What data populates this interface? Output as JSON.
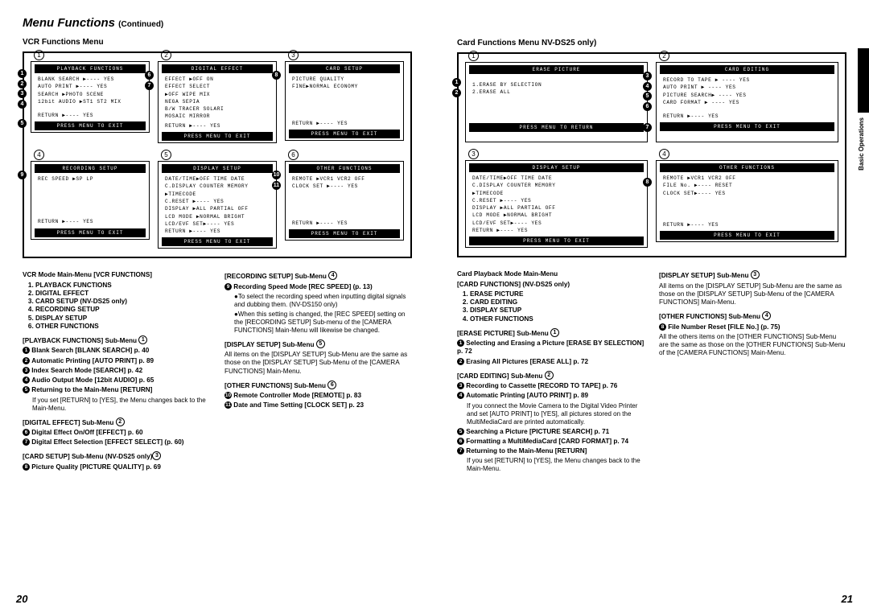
{
  "header": {
    "title": "Menu Functions",
    "continued": "(Continued)"
  },
  "side_tab": "Basic Operations",
  "page_numbers": {
    "left": "20",
    "right": "21"
  },
  "left": {
    "subtitle": "VCR Functions Menu",
    "screens": {
      "1": {
        "title": "PLAYBACK FUNCTIONS",
        "lines": [
          "BLANK SEARCH ▶---- YES",
          "AUTO PRINT  ▶---- YES",
          "SEARCH      ▶PHOTO SCENE",
          "12bit AUDIO ▶ST1 ST2 MIX"
        ],
        "return": "RETURN ▶---- YES",
        "footer": "PRESS MENU TO EXIT"
      },
      "2": {
        "title": "DIGITAL EFFECT",
        "lines": [
          "EFFECT      ▶OFF   ON",
          "EFFECT SELECT",
          "   ▶OFF  WIPE  MIX",
          "    NEGA       SEPIA",
          "    B/W  TRACER SOLARI",
          "    MOSAIC MIRROR"
        ],
        "return": "RETURN ▶---- YES",
        "footer": "PRESS MENU TO EXIT"
      },
      "3": {
        "title": "CARD SETUP",
        "lines": [
          "PICTURE QUALITY",
          "   FINE▶NORMAL ECONOMY"
        ],
        "return": "RETURN ▶---- YES",
        "footer": "PRESS MENU TO EXIT"
      },
      "4": {
        "title": "RECORDING SETUP",
        "lines": [
          "REC SPEED   ▶SP   LP"
        ],
        "return": "RETURN ▶---- YES",
        "footer": "PRESS MENU TO EXIT"
      },
      "5": {
        "title": "DISPLAY SETUP",
        "lines": [
          "DATE/TIME▶OFF TIME DATE",
          "C.DISPLAY COUNTER MEMORY",
          "          ▶TIMECODE",
          "C.RESET   ▶---- YES",
          "DISPLAY ▶ALL PARTIAL OFF",
          "LCD MODE  ▶NORMAL BRIGHT",
          "LCD/EVF SET▶---- YES"
        ],
        "return": "RETURN ▶---- YES",
        "footer": "PRESS MENU TO EXIT"
      },
      "6": {
        "title": "OTHER FUNCTIONS",
        "lines": [
          "REMOTE  ▶VCR1 VCR2 OFF",
          "CLOCK SET ▶----  YES"
        ],
        "return": "RETURN ▶---- YES",
        "footer": "PRESS MENU TO EXIT"
      }
    },
    "desc": {
      "main_title": "VCR Mode Main-Menu [VCR FUNCTIONS]",
      "main_items": [
        "PLAYBACK FUNCTIONS",
        "DIGITAL EFFECT",
        "CARD SETUP (NV-DS25 only)",
        "RECORDING SETUP",
        "DISPLAY SETUP",
        "OTHER FUNCTIONS"
      ],
      "sub1_title": "[PLAYBACK FUNCTIONS] Sub-Menu ",
      "sub1_items": [
        "Blank Search [BLANK SEARCH] p. 40",
        "Automatic Printing [AUTO PRINT] p. 89",
        "Index Search Mode [SEARCH] p. 42",
        "Audio Output Mode [12bit AUDIO] p. 65",
        "Returning to the Main-Menu [RETURN]"
      ],
      "sub1_note": "If you set [RETURN] to [YES], the Menu changes back to the Main-Menu.",
      "sub2_title": "[DIGITAL EFFECT] Sub-Menu ",
      "sub2_items": [
        "Digital Effect On/Off [EFFECT] p. 60",
        "Digital Effect Selection [EFFECT SELECT] (p. 60)"
      ],
      "sub3_title": "[CARD SETUP] Sub-Menu  (NV-DS25 only)",
      "sub3_items": [
        "Picture Quality [PICTURE QUALITY] p. 69"
      ],
      "sub4_title": "[RECORDING SETUP] Sub-Menu ",
      "sub4_items": [
        "Recording Speed Mode [REC SPEED] (p. 13)"
      ],
      "sub4_note1": "●To select the recording speed when inputting digital signals and dubbing them. (NV-DS150 only)",
      "sub4_note2": "●When this setting is changed, the [REC SPEED] setting on the [RECORDING SETUP] Sub-menu of the [CAMERA FUNCTIONS] Main-Menu will likewise be changed.",
      "sub5_title": "[DISPLAY SETUP] Sub-Menu ",
      "sub5_note": "All items on the [DISPLAY SETUP] Sub-Menu are the same as those on the [DISPLAY SETUP] Sub-Menu of the [CAMERA FUNCTIONS] Main-Menu.",
      "sub6_title": "[OTHER FUNCTIONS] Sub-Menu ",
      "sub6_items": [
        "Remote Controller Mode [REMOTE] p. 83",
        "Date and Time Setting [CLOCK SET] p. 23"
      ]
    }
  },
  "right": {
    "subtitle": "Card Functions Menu NV-DS25 only)",
    "screens": {
      "1": {
        "title": "ERASE PICTURE",
        "lines": [
          "1.ERASE BY SELECTION",
          "2.ERASE ALL"
        ],
        "footer": "PRESS MENU TO RETURN"
      },
      "2": {
        "title": "CARD EDITING",
        "lines": [
          "RECORD TO TAPE ▶ ---- YES",
          "AUTO PRINT    ▶ ---- YES",
          "PICTURE SEARCH▶ ---- YES",
          "CARD FORMAT   ▶ ---- YES"
        ],
        "return": "RETURN ▶---- YES",
        "footer": "PRESS MENU TO EXIT"
      },
      "3": {
        "title": "DISPLAY SETUP",
        "lines": [
          "DATE/TIME▶OFF TIME DATE",
          "C.DISPLAY COUNTER MEMORY",
          "          ▶TIMECODE",
          "C.RESET   ▶---- YES",
          "DISPLAY ▶ALL PARTIAL OFF",
          "LCD MODE  ▶NORMAL BRIGHT",
          "LCD/EVF SET▶---- YES"
        ],
        "return": "RETURN ▶---- YES",
        "footer": "PRESS MENU TO EXIT"
      },
      "4": {
        "title": "OTHER FUNCTIONS",
        "lines": [
          "REMOTE   ▶VCR1 VCR2 OFF",
          "FILE No. ▶----   RESET",
          "CLOCK SET▶----   YES"
        ],
        "return": "RETURN ▶---- YES",
        "footer": "PRESS MENU TO EXIT"
      }
    },
    "desc": {
      "main_title1": "Card Playback Mode Main-Menu",
      "main_title2": "[CARD FUNCTIONS] (NV-DS25 only)",
      "main_items": [
        "ERASE PICTURE",
        "CARD EDITING",
        "DISPLAY SETUP",
        "OTHER FUNCTIONS"
      ],
      "sub1_title": "[ERASE PICTURE] Sub-Menu ",
      "sub1_items": [
        "Selecting and Erasing a Picture [ERASE BY SELECTION] p. 72",
        "Erasing All Pictures [ERASE ALL] p. 72"
      ],
      "sub2_title": "[CARD EDITING] Sub-Menu ",
      "sub2_items": [
        "Recording to Cassette [RECORD TO TAPE] p. 76",
        "Automatic Printing [AUTO PRINT] p. 89"
      ],
      "sub2_note": "If you connect the Movie Camera to the Digital Video Printer and set [AUTO PRINT] to [YES], all pictures stored on the MultiMediaCard are printed automatically.",
      "sub2_items2": [
        "Searching a Picture [PICTURE SEARCH] p. 71",
        "Formatting a MultiMediaCard [CARD FORMAT] p. 74",
        "Returning to the Main-Menu [RETURN]"
      ],
      "sub2_note2": "If you set [RETURN] to [YES], the Menu changes back to the Main-Menu.",
      "sub3_title": "[DISPLAY SETUP] Sub-Menu ",
      "sub3_note": "All items on the [DISPLAY SETUP] Sub-Menu are the same as those on the [DISPLAY SETUP] Sub-Menu of the [CAMERA FUNCTIONS] Main-Menu.",
      "sub4_title": "[OTHER FUNCTIONS] Sub-Menu ",
      "sub4_items": [
        "File Number Reset [FILE No.] (p. 75)"
      ],
      "sub4_note": "All the others items on the [OTHER FUNCTIONS] Sub-Menu are the same as those on the [OTHER FUNCTIONS] Sub-Menu of the [CAMERA FUNCTIONS] Main-Menu."
    }
  }
}
